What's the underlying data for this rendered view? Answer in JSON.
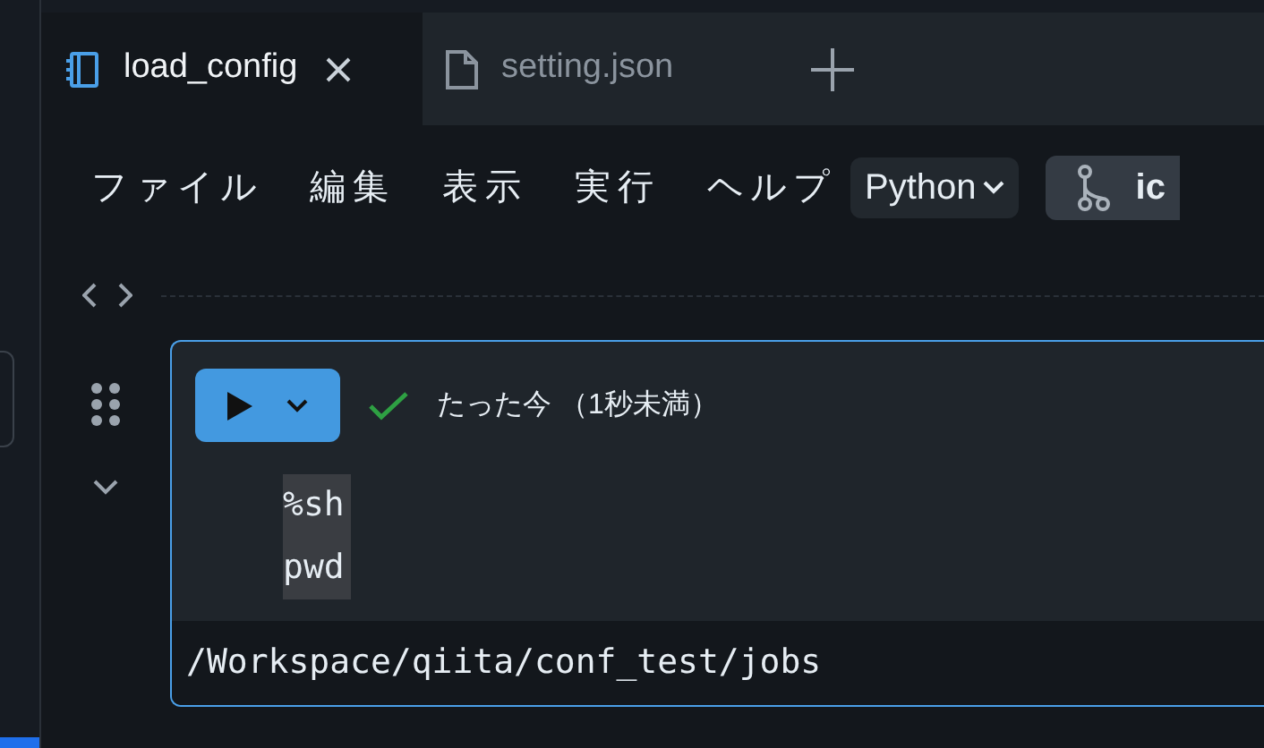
{
  "tabs": [
    {
      "kind": "notebook",
      "label": "load_config",
      "selected": true,
      "closable": true
    },
    {
      "kind": "file",
      "label": "setting.json",
      "selected": false,
      "closable": false
    }
  ],
  "menu": [
    {
      "label": "ファイル"
    },
    {
      "label": "編集"
    },
    {
      "label": "表示"
    },
    {
      "label": "実行"
    },
    {
      "label": "ヘルプ"
    }
  ],
  "language": {
    "label": "Python"
  },
  "branch_button": {
    "label": "ic"
  },
  "cell": {
    "selected": true,
    "succeeded": true,
    "status": "たった今 （1秒未満）",
    "code": [
      "%sh",
      "pwd"
    ],
    "output": "/Workspace/qiita/conf_test/jobs"
  }
}
